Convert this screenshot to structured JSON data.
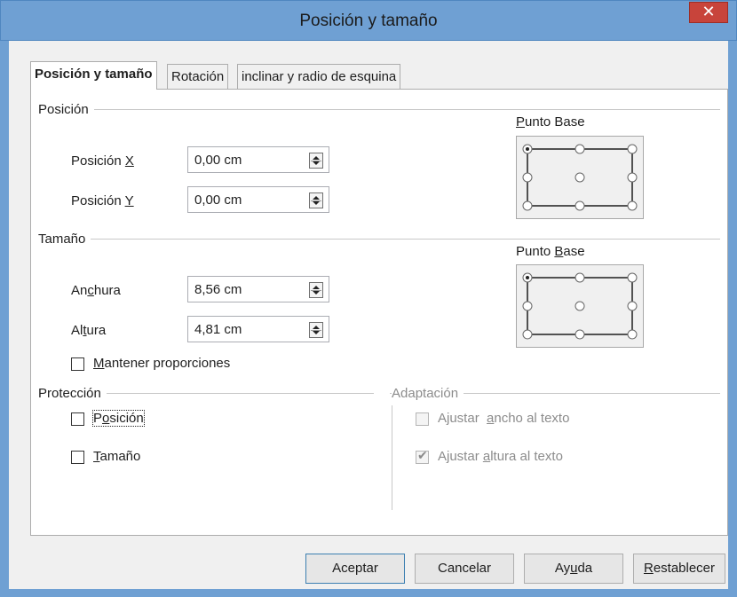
{
  "dialog": {
    "title": "Posición y tamaño",
    "close_glyph": "✕"
  },
  "tabs": [
    {
      "label": "Posición y tamaño",
      "active": true
    },
    {
      "label": "Rotación",
      "active": false
    },
    {
      "label": "inclinar y radio de esquina",
      "active": false
    }
  ],
  "position": {
    "section_label": "Posición",
    "x_label_pre": "Posición ",
    "x_label_accel": "X",
    "x_value": "0,00 cm",
    "y_label_pre": "Posición ",
    "y_label_accel": "Y",
    "y_value": "0,00 cm",
    "base_point_title_accel": "P",
    "base_point_title_rest": "unto Base",
    "selected_point": "top-left"
  },
  "size": {
    "section_label": "Tamaño",
    "width_label_pre": "An",
    "width_label_accel": "c",
    "width_label_post": "hura",
    "width_value": "8,56 cm",
    "height_label_pre": "Al",
    "height_label_accel": "t",
    "height_label_post": "ura",
    "height_value": "4,81 cm",
    "keep_ratio_accel": "M",
    "keep_ratio_rest": "antener proporciones",
    "keep_ratio_checked": false,
    "base_point_title_pre": "Punto ",
    "base_point_title_accel": "B",
    "base_point_title_post": "ase",
    "selected_point": "top-left"
  },
  "protection": {
    "section_label": "Protección",
    "position_pre": "P",
    "position_accel": "o",
    "position_post": "sición",
    "position_checked": false,
    "size_accel": "T",
    "size_rest": "amaño",
    "size_checked": false
  },
  "adaptation": {
    "section_label": "Adaptación",
    "fit_width_pre": "Ajustar  ",
    "fit_width_accel": "a",
    "fit_width_post": "ncho al texto",
    "fit_width_checked": false,
    "fit_height_pre": "Ajustar ",
    "fit_height_accel": "a",
    "fit_height_post": "ltura al texto",
    "fit_height_checked": true
  },
  "buttons": {
    "ok": "Aceptar",
    "cancel": "Cancelar",
    "help_pre": "Ay",
    "help_accel": "u",
    "help_post": "da",
    "reset_accel": "R",
    "reset_rest": "establecer"
  },
  "colors": {
    "titlebar": "#6fa0d3",
    "close": "#c8443b",
    "default_button_border": "#3c7fb1"
  }
}
